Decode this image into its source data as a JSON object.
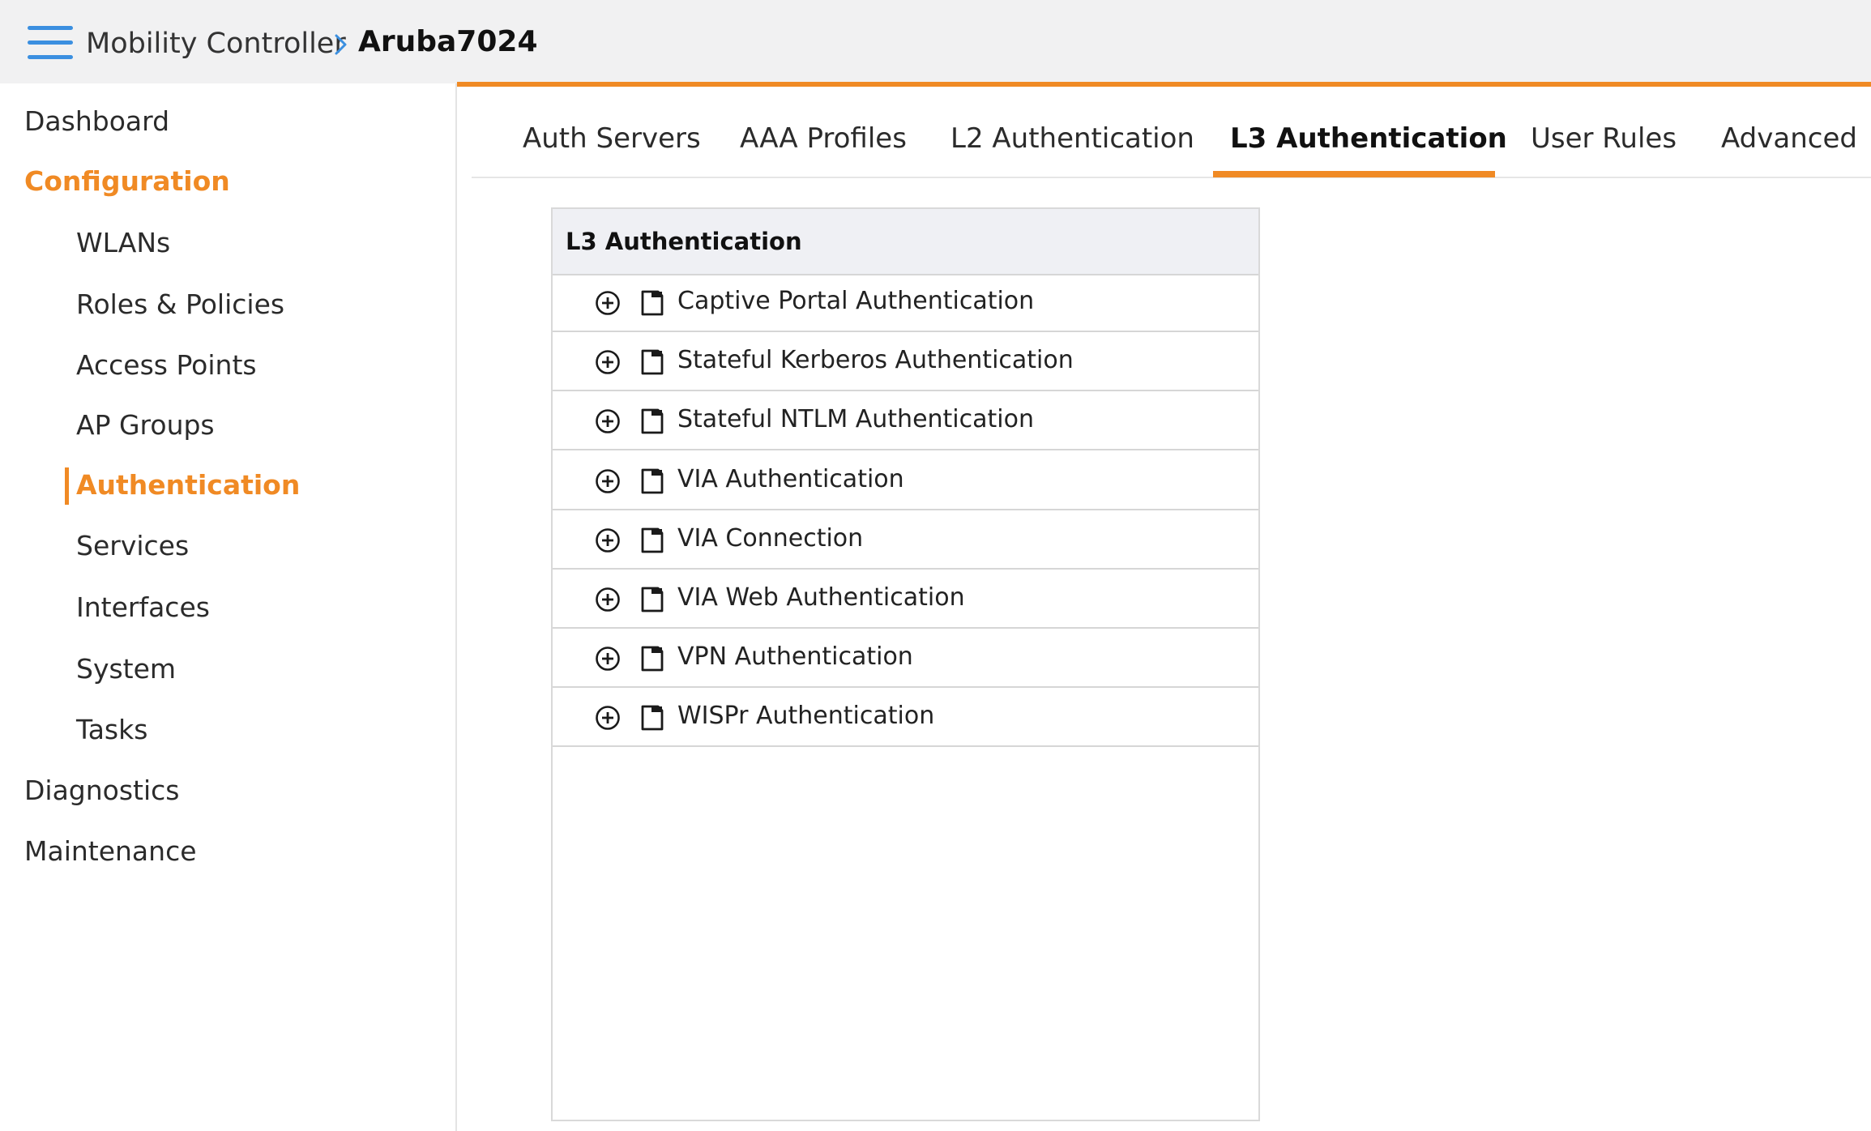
{
  "header": {
    "breadcrumb_root": "Mobility Controller",
    "breadcrumb_current": "Aruba7024"
  },
  "sidebar": {
    "items": [
      {
        "label": "Dashboard"
      },
      {
        "label": "Configuration"
      },
      {
        "label": "WLANs"
      },
      {
        "label": "Roles & Policies"
      },
      {
        "label": "Access Points"
      },
      {
        "label": "AP Groups"
      },
      {
        "label": "Authentication"
      },
      {
        "label": "Services"
      },
      {
        "label": "Interfaces"
      },
      {
        "label": "System"
      },
      {
        "label": "Tasks"
      },
      {
        "label": "Diagnostics"
      },
      {
        "label": "Maintenance"
      }
    ],
    "active_group": "Configuration",
    "active_item": "Authentication"
  },
  "tabs": [
    {
      "label": "Auth Servers"
    },
    {
      "label": "AAA Profiles"
    },
    {
      "label": "L2 Authentication"
    },
    {
      "label": "L3 Authentication"
    },
    {
      "label": "User Rules"
    },
    {
      "label": "Advanced"
    }
  ],
  "active_tab": "L3 Authentication",
  "panel": {
    "title": "L3 Authentication",
    "rows": [
      {
        "label": "Captive Portal Authentication"
      },
      {
        "label": "Stateful Kerberos Authentication"
      },
      {
        "label": "Stateful NTLM Authentication"
      },
      {
        "label": "VIA Authentication"
      },
      {
        "label": "VIA Connection"
      },
      {
        "label": "VIA Web Authentication"
      },
      {
        "label": "VPN Authentication"
      },
      {
        "label": "WISPr Authentication"
      }
    ]
  },
  "colors": {
    "accent": "#f08a24",
    "menu_icon": "#3b8fe0",
    "header_bg": "#f1f1f2",
    "panel_header_bg": "#eff0f4"
  },
  "icons": {
    "menu": "hamburger-menu-icon",
    "breadcrumb_separator": "chevron-right-icon",
    "row_expand": "plus-circle-icon",
    "row_profile": "document-icon"
  }
}
